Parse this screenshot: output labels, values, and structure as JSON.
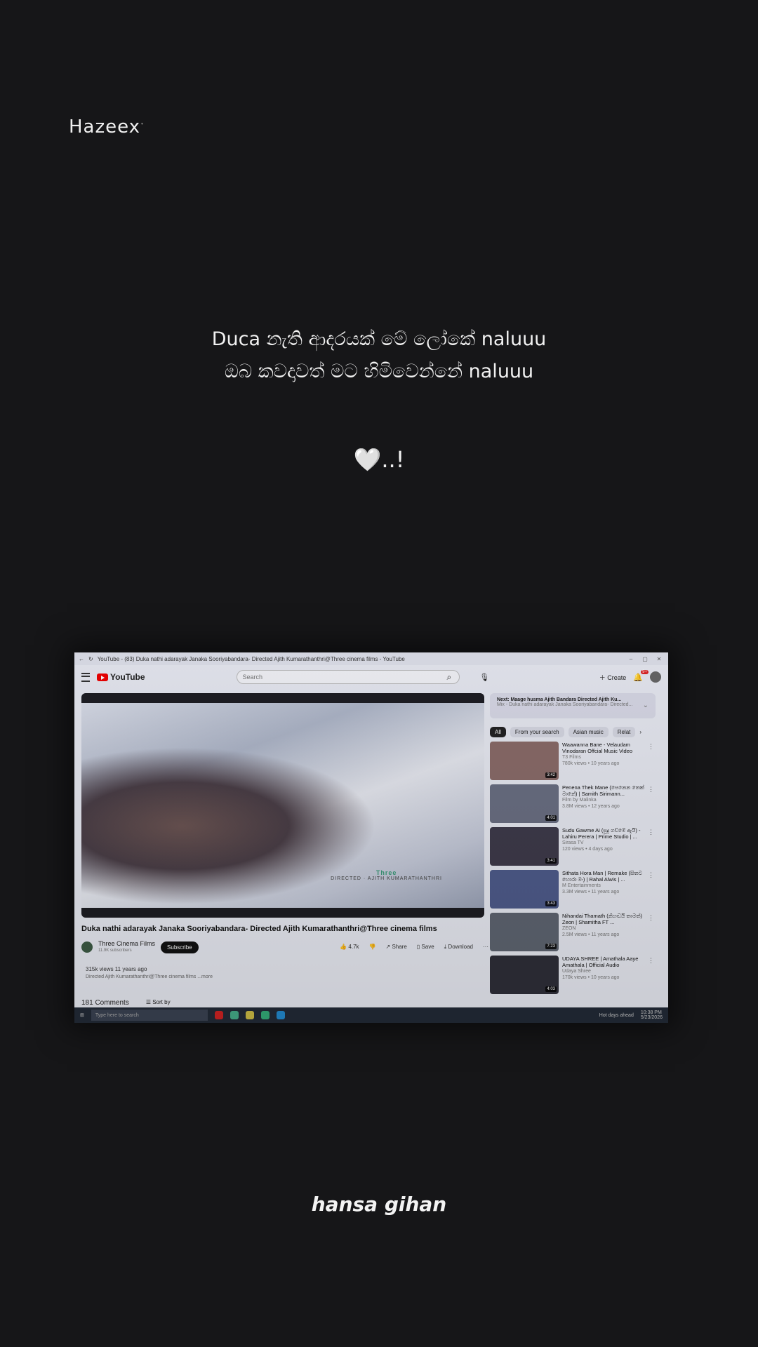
{
  "brand": "Hazeex",
  "lyrics": {
    "line1": "Duca නැති ආදරයක් මේ ලෝකේ naluuu",
    "line2": "ඔබ කවදාවත් මට හිමිවෙන්නේ naluuu"
  },
  "heart_text": "🤍..!",
  "signature": "hansa gihan",
  "screen": {
    "window_title": "YouTube - (83) Duka nathi adarayak Janaka Sooriyabandara- Directed Ajith Kumarathanthri@Three cinema films - YouTube",
    "logo": "YouTube",
    "search_placeholder": "Search",
    "create_label": "Create",
    "notif_badge": "9+",
    "video_watermark_brand": "Three",
    "video_watermark": "DIRECTED · AJITH KUMARATHANTHRI",
    "video_title": "Duka nathi adarayak Janaka Sooriyabandara- Directed Ajith Kumarathanthri@Three cinema films",
    "channel_name": "Three Cinema Films",
    "channel_subs": "11.9K subscribers",
    "subscribe_label": "Subscribe",
    "likes": "4.7k",
    "share_label": "Share",
    "save_label": "Save",
    "download_label": "Download",
    "views_line": "315k views  11 years ago",
    "desc_line": "Directed Ajith Kumarathanthri@Three cinema films ...more",
    "comments_label": "181 Comments",
    "sort_label": "Sort by",
    "next": {
      "title": "Next: Maage husma Ajith Bandara Directed Ajith Ku...",
      "sub": "Mix - Duka nathi adarayak Janaka Sooriyabandara- Directed..."
    },
    "chips": [
      "All",
      "From your search",
      "Asian music",
      "Relat"
    ],
    "recs": [
      {
        "title": "Waawanna Bane - Velaudam Vinodaran Offcial Music Video",
        "channel": "T3 Films",
        "meta": "780k views • 10 years ago",
        "dur": "3:42",
        "color": "#8a6b68"
      },
      {
        "title": "Penena Thek Mane (පෙනෙන තෙක් මානේ) | Samith Sirimann...",
        "channel": "Film by Malinka",
        "meta": "3.8M views • 12 years ago",
        "dur": "4:01",
        "color": "#6a6f82"
      },
      {
        "title": "Sudu Gawme Ai (සුදු ගව්මේ ඇයි) - Lahiru Perera | Prime Studio | ...",
        "channel": "Sirasa TV",
        "meta": "120 views • 4 days ago",
        "dur": "3:41",
        "color": "#3e3a4a"
      },
      {
        "title": "Sithata Hora Man | Remake (සිතට හොරා මං) | Rahal Alwis | ...",
        "channel": "M Entertainments",
        "meta": "3.3M views • 11 years ago",
        "dur": "3:43",
        "color": "#4e5b8a"
      },
      {
        "title": "Nihandai Thamath (නිහඬයි තාමත්) Zeon | Shamitha FT ...",
        "channel": "ZEON",
        "meta": "2.5M views • 11 years ago",
        "dur": "7:23",
        "color": "#5e6470"
      },
      {
        "title": "UDAYA SHREE | Amathala Aaye Amathala | Official Audio",
        "channel": "Udaya Shree",
        "meta": "170k views • 10 years ago",
        "dur": "4:03",
        "color": "#2e2e38"
      }
    ],
    "taskbar": {
      "search_placeholder": "Type here to search",
      "weather": "Hot days ahead",
      "time": "10:38 PM",
      "date": "5/23/2026"
    }
  }
}
